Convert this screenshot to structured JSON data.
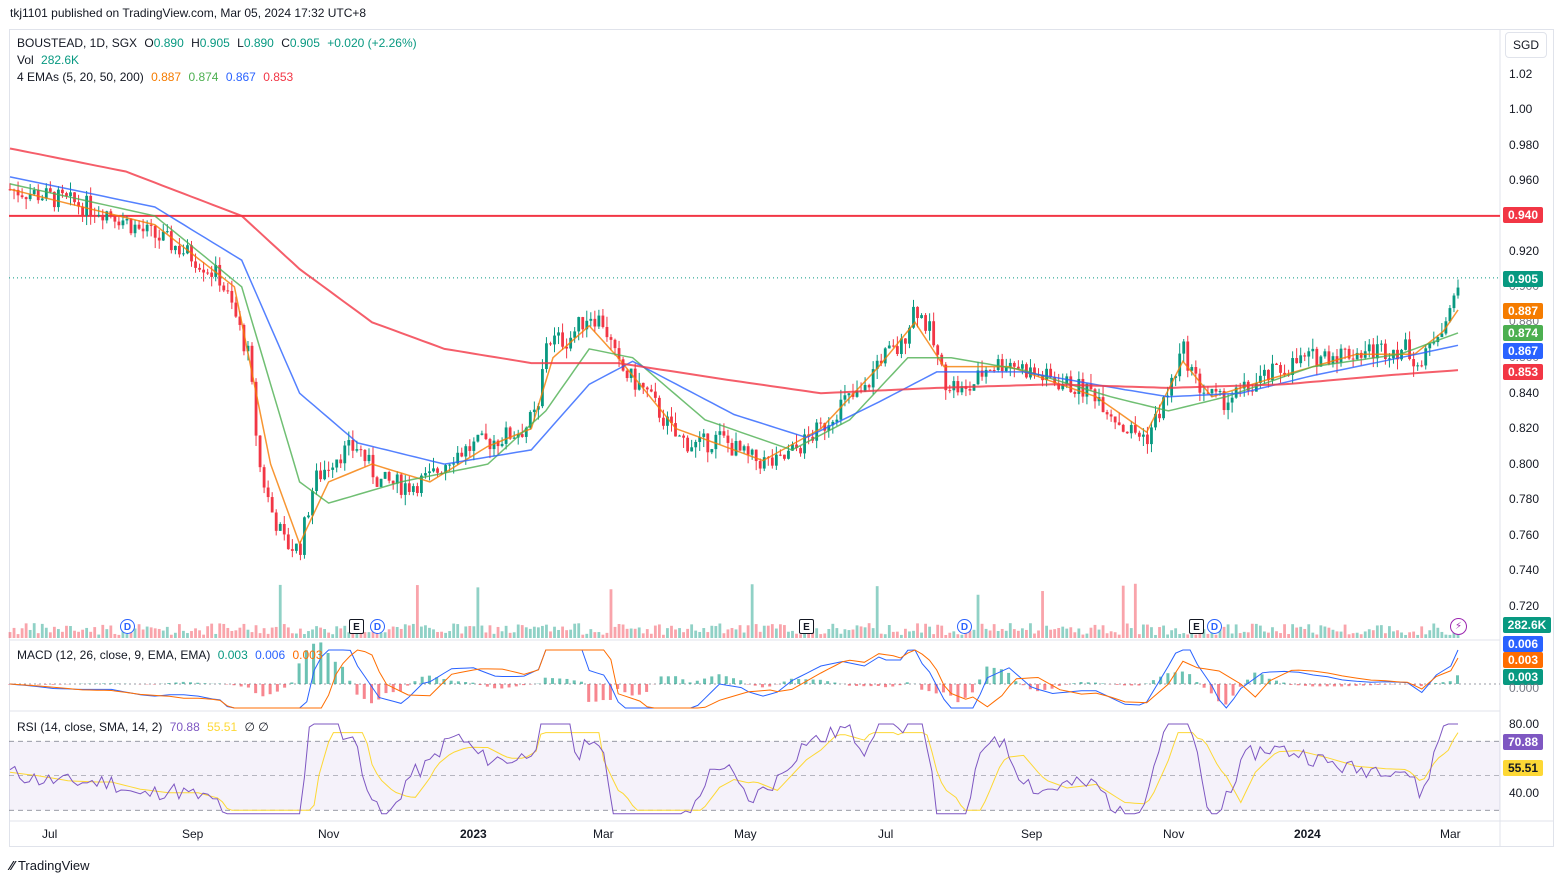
{
  "header": {
    "publish_line": "tkj1101 published on TradingView.com, Mar 05, 2024 17:32 UTC+8"
  },
  "legend": {
    "symbol": "BOUSTEAD, 1D, SGX",
    "o_label": "O",
    "o_value": "0.890",
    "h_label": "H",
    "h_value": "0.905",
    "l_label": "L",
    "l_value": "0.890",
    "c_label": "C",
    "c_value": "0.905",
    "change": "+0.020 (+2.26%)",
    "vol_label": "Vol",
    "vol_value": "282.6K",
    "ema_label": "4 EMAs (5, 20, 50, 200)",
    "ema_values": [
      "0.887",
      "0.874",
      "0.867",
      "0.853"
    ],
    "macd_label": "MACD (12, 26, close, 9, EMA, EMA)",
    "macd_values": [
      "0.003",
      "0.006",
      "0.003"
    ],
    "rsi_label": "RSI (14, close, SMA, 14, 2)",
    "rsi_values": [
      "70.88",
      "55.51"
    ],
    "rsi_extra": "∅ ∅"
  },
  "currency": "SGD",
  "colors": {
    "up": "#089981",
    "down": "#f23645",
    "ema5": "#f57c00",
    "ema20": "#4caf50",
    "ema50": "#2962ff",
    "ema200": "#f23645",
    "rsi": "#7e57c2",
    "rsi_ma": "#fdd835",
    "macd": "#2962ff",
    "signal": "#ff6d00",
    "hline": "#f23645"
  },
  "price_scale_ticks": [
    "1.02",
    "1.00",
    "0.980",
    "0.960",
    "0.940",
    "0.920",
    "0.900",
    "0.880",
    "0.860",
    "0.840",
    "0.820",
    "0.800",
    "0.780",
    "0.760",
    "0.740",
    "0.720"
  ],
  "price_tags": [
    {
      "text": "0.940",
      "value": 0.94,
      "color": "#f23645"
    },
    {
      "text": "0.905",
      "value": 0.905,
      "color": "#089981"
    },
    {
      "text": "0.887",
      "value": 0.887,
      "color": "#f57c00"
    },
    {
      "text": "0.874",
      "value": 0.874,
      "color": "#4caf50"
    },
    {
      "text": "0.867",
      "value": 0.867,
      "color": "#2962ff"
    },
    {
      "text": "0.853",
      "value": 0.853,
      "color": "#f23645"
    }
  ],
  "vol_tag": "282.6K",
  "macd_tags": [
    "0.006",
    "0.003",
    "0.003"
  ],
  "macd_scale_label": "0.000",
  "rsi_scale_ticks": [
    "80.00",
    "40.00"
  ],
  "rsi_tags": [
    "70.88",
    "55.51"
  ],
  "x_labels": [
    "Jul",
    "Sep",
    "Nov",
    "2023",
    "Mar",
    "May",
    "Jul",
    "Sep",
    "Nov",
    "2024",
    "Mar"
  ],
  "events": [
    "D",
    "E",
    "D",
    "E",
    "D",
    "E",
    "D"
  ],
  "footer": {
    "brand": "TradingView"
  },
  "chart_data": {
    "type": "candlestick",
    "title": "BOUSTEAD, 1D, SGX",
    "ylim": [
      0.71,
      1.03
    ],
    "horizontal_line": 0.94,
    "last_close": 0.905,
    "price_path": [
      [
        0.0,
        0.955
      ],
      [
        0.02,
        0.952
      ],
      [
        0.04,
        0.948
      ],
      [
        0.07,
        0.942
      ],
      [
        0.09,
        0.932
      ],
      [
        0.11,
        0.925
      ],
      [
        0.13,
        0.915
      ],
      [
        0.145,
        0.905
      ],
      [
        0.155,
        0.885
      ],
      [
        0.165,
        0.86
      ],
      [
        0.172,
        0.8
      ],
      [
        0.18,
        0.775
      ],
      [
        0.19,
        0.755
      ],
      [
        0.2,
        0.752
      ],
      [
        0.21,
        0.79
      ],
      [
        0.225,
        0.805
      ],
      [
        0.24,
        0.81
      ],
      [
        0.255,
        0.79
      ],
      [
        0.275,
        0.788
      ],
      [
        0.29,
        0.792
      ],
      [
        0.305,
        0.805
      ],
      [
        0.32,
        0.81
      ],
      [
        0.34,
        0.815
      ],
      [
        0.355,
        0.82
      ],
      [
        0.365,
        0.83
      ],
      [
        0.37,
        0.87
      ],
      [
        0.385,
        0.87
      ],
      [
        0.4,
        0.885
      ],
      [
        0.41,
        0.88
      ],
      [
        0.42,
        0.855
      ],
      [
        0.44,
        0.84
      ],
      [
        0.46,
        0.815
      ],
      [
        0.475,
        0.81
      ],
      [
        0.49,
        0.815
      ],
      [
        0.51,
        0.803
      ],
      [
        0.53,
        0.8
      ],
      [
        0.545,
        0.81
      ],
      [
        0.56,
        0.82
      ],
      [
        0.575,
        0.835
      ],
      [
        0.59,
        0.84
      ],
      [
        0.6,
        0.86
      ],
      [
        0.615,
        0.865
      ],
      [
        0.625,
        0.89
      ],
      [
        0.635,
        0.875
      ],
      [
        0.645,
        0.848
      ],
      [
        0.66,
        0.84
      ],
      [
        0.675,
        0.855
      ],
      [
        0.69,
        0.858
      ],
      [
        0.71,
        0.85
      ],
      [
        0.73,
        0.845
      ],
      [
        0.75,
        0.84
      ],
      [
        0.77,
        0.82
      ],
      [
        0.785,
        0.815
      ],
      [
        0.8,
        0.84
      ],
      [
        0.81,
        0.865
      ],
      [
        0.82,
        0.845
      ],
      [
        0.835,
        0.835
      ],
      [
        0.85,
        0.84
      ],
      [
        0.87,
        0.85
      ],
      [
        0.89,
        0.858
      ],
      [
        0.91,
        0.862
      ],
      [
        0.93,
        0.863
      ],
      [
        0.95,
        0.865
      ],
      [
        0.965,
        0.865
      ],
      [
        0.975,
        0.855
      ],
      [
        0.985,
        0.875
      ],
      [
        0.995,
        0.885
      ],
      [
        1.0,
        0.905
      ]
    ],
    "ema_paths": {
      "ema5": [
        [
          0.0,
          0.955
        ],
        [
          0.1,
          0.935
        ],
        [
          0.155,
          0.9
        ],
        [
          0.18,
          0.8
        ],
        [
          0.2,
          0.755
        ],
        [
          0.22,
          0.79
        ],
        [
          0.25,
          0.8
        ],
        [
          0.29,
          0.79
        ],
        [
          0.33,
          0.81
        ],
        [
          0.36,
          0.82
        ],
        [
          0.375,
          0.86
        ],
        [
          0.4,
          0.878
        ],
        [
          0.42,
          0.86
        ],
        [
          0.46,
          0.82
        ],
        [
          0.52,
          0.802
        ],
        [
          0.56,
          0.82
        ],
        [
          0.6,
          0.855
        ],
        [
          0.625,
          0.88
        ],
        [
          0.645,
          0.855
        ],
        [
          0.69,
          0.855
        ],
        [
          0.75,
          0.838
        ],
        [
          0.785,
          0.818
        ],
        [
          0.81,
          0.858
        ],
        [
          0.83,
          0.838
        ],
        [
          0.87,
          0.848
        ],
        [
          0.93,
          0.862
        ],
        [
          0.97,
          0.862
        ],
        [
          0.99,
          0.875
        ],
        [
          1.0,
          0.887
        ]
      ],
      "ema20": [
        [
          0.0,
          0.958
        ],
        [
          0.1,
          0.94
        ],
        [
          0.16,
          0.9
        ],
        [
          0.2,
          0.79
        ],
        [
          0.22,
          0.778
        ],
        [
          0.27,
          0.79
        ],
        [
          0.33,
          0.8
        ],
        [
          0.37,
          0.83
        ],
        [
          0.4,
          0.865
        ],
        [
          0.43,
          0.86
        ],
        [
          0.48,
          0.825
        ],
        [
          0.54,
          0.808
        ],
        [
          0.58,
          0.825
        ],
        [
          0.62,
          0.86
        ],
        [
          0.65,
          0.86
        ],
        [
          0.7,
          0.853
        ],
        [
          0.76,
          0.838
        ],
        [
          0.8,
          0.83
        ],
        [
          0.84,
          0.838
        ],
        [
          0.9,
          0.855
        ],
        [
          0.96,
          0.862
        ],
        [
          1.0,
          0.874
        ]
      ],
      "ema50": [
        [
          0.0,
          0.962
        ],
        [
          0.1,
          0.945
        ],
        [
          0.16,
          0.915
        ],
        [
          0.2,
          0.84
        ],
        [
          0.24,
          0.812
        ],
        [
          0.3,
          0.8
        ],
        [
          0.36,
          0.808
        ],
        [
          0.4,
          0.845
        ],
        [
          0.43,
          0.858
        ],
        [
          0.5,
          0.828
        ],
        [
          0.55,
          0.815
        ],
        [
          0.6,
          0.835
        ],
        [
          0.64,
          0.852
        ],
        [
          0.7,
          0.852
        ],
        [
          0.77,
          0.842
        ],
        [
          0.8,
          0.838
        ],
        [
          0.85,
          0.84
        ],
        [
          0.9,
          0.85
        ],
        [
          0.96,
          0.86
        ],
        [
          1.0,
          0.867
        ]
      ],
      "ema200": [
        [
          0.0,
          0.978
        ],
        [
          0.08,
          0.965
        ],
        [
          0.16,
          0.94
        ],
        [
          0.2,
          0.91
        ],
        [
          0.25,
          0.88
        ],
        [
          0.3,
          0.865
        ],
        [
          0.36,
          0.857
        ],
        [
          0.42,
          0.857
        ],
        [
          0.5,
          0.847
        ],
        [
          0.56,
          0.84
        ],
        [
          0.64,
          0.843
        ],
        [
          0.72,
          0.845
        ],
        [
          0.8,
          0.843
        ],
        [
          0.88,
          0.845
        ],
        [
          0.95,
          0.85
        ],
        [
          1.0,
          0.853
        ]
      ]
    }
  }
}
